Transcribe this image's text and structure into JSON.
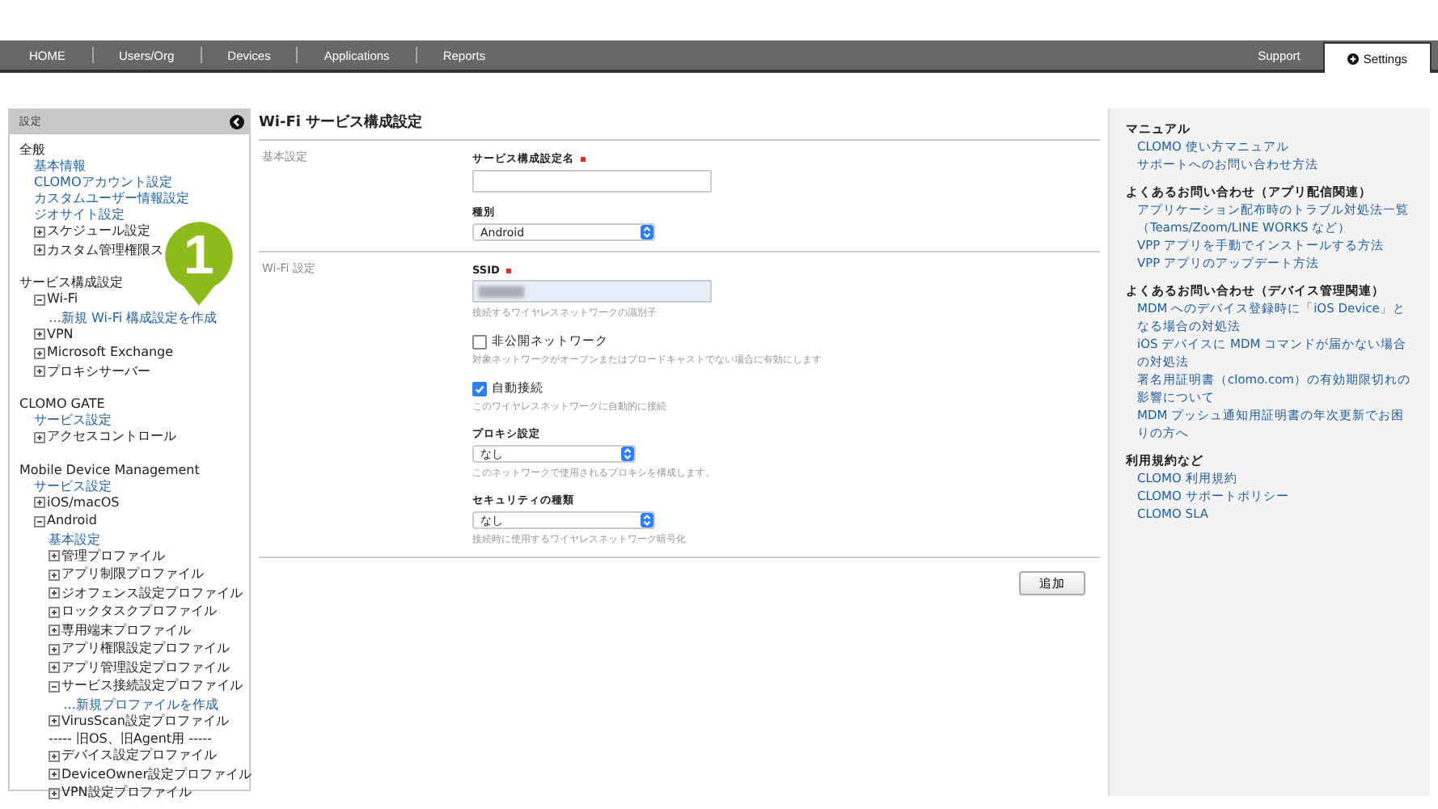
{
  "nav": {
    "tabs": [
      {
        "label": "HOME",
        "selected": false
      },
      {
        "label": "Users/Org",
        "selected": false
      },
      {
        "label": "Devices",
        "selected": false
      },
      {
        "label": "Applications",
        "selected": false
      },
      {
        "label": "Reports",
        "selected": false
      }
    ],
    "right_tabs": [
      {
        "label": "Support",
        "selected": false,
        "icon": false
      },
      {
        "label": "Settings",
        "selected": true,
        "icon": true
      }
    ]
  },
  "sidebar": {
    "title": "設定",
    "groups": [
      {
        "title": "全般",
        "children": [
          {
            "kind": "link",
            "label": "基本情報"
          },
          {
            "kind": "link",
            "label": "CLOMOアカウント設定"
          },
          {
            "kind": "link",
            "label": "カスタムユーザー情報設定"
          },
          {
            "kind": "link",
            "label": "ジオサイト設定"
          },
          {
            "kind": "node",
            "label": "スケジュール設定",
            "expanded": false
          },
          {
            "kind": "node",
            "label": "カスタム管理権限ス",
            "expanded": false
          }
        ]
      },
      {
        "title": "サービス構成設定",
        "children": [
          {
            "kind": "node",
            "label": "Wi-Fi",
            "expanded": true,
            "children": [
              {
                "kind": "link",
                "label": "…新規 Wi-Fi 構成設定を作成"
              }
            ]
          },
          {
            "kind": "node",
            "label": "VPN",
            "expanded": false
          },
          {
            "kind": "node",
            "label": "Microsoft Exchange",
            "expanded": false
          },
          {
            "kind": "node",
            "label": "プロキシサーバー",
            "expanded": false
          }
        ]
      },
      {
        "title": "CLOMO GATE",
        "children": [
          {
            "kind": "link",
            "label": "サービス設定"
          },
          {
            "kind": "node",
            "label": "アクセスコントロール",
            "expanded": false
          }
        ]
      },
      {
        "title": "Mobile Device Management",
        "children": [
          {
            "kind": "link",
            "label": "サービス設定"
          },
          {
            "kind": "node",
            "label": "iOS/macOS",
            "expanded": false
          },
          {
            "kind": "node",
            "label": "Android",
            "expanded": true,
            "children": [
              {
                "kind": "link",
                "label": "基本設定"
              },
              {
                "kind": "node",
                "label": "管理プロファイル",
                "expanded": false
              },
              {
                "kind": "node",
                "label": "アプリ制限プロファイル",
                "expanded": false
              },
              {
                "kind": "node",
                "label": "ジオフェンス設定プロファイル",
                "expanded": false
              },
              {
                "kind": "node",
                "label": "ロックタスクプロファイル",
                "expanded": false
              },
              {
                "kind": "node",
                "label": "専用端末プロファイル",
                "expanded": false
              },
              {
                "kind": "node",
                "label": "アプリ権限設定プロファイル",
                "expanded": false
              },
              {
                "kind": "node",
                "label": "アプリ管理設定プロファイル",
                "expanded": false
              },
              {
                "kind": "node",
                "label": "サービス接続設定プロファイル",
                "expanded": true,
                "children": [
                  {
                    "kind": "link",
                    "label": "…新規プロファイルを作成"
                  }
                ]
              },
              {
                "kind": "node",
                "label": "VirusScan設定プロファイル",
                "expanded": false
              },
              {
                "kind": "separator",
                "label": "----- 旧OS、旧Agent用 -----"
              },
              {
                "kind": "node",
                "label": "デバイス設定プロファイル",
                "expanded": false
              },
              {
                "kind": "node",
                "label": "DeviceOwner設定プロファイル",
                "expanded": false
              },
              {
                "kind": "node",
                "label": "VPN設定プロファイル",
                "expanded": false
              }
            ]
          }
        ]
      }
    ]
  },
  "marker": {
    "label": "1"
  },
  "main": {
    "title": "Wi-Fi サービス構成設定",
    "sections": [
      {
        "label": "基本設定",
        "fields": [
          {
            "kind": "text",
            "label": "サービス構成設定名",
            "required": true,
            "value_hidden": false
          },
          {
            "kind": "select",
            "label": "種別",
            "value": "Android"
          }
        ]
      },
      {
        "label": "Wi-Fi 設定",
        "fields": [
          {
            "kind": "text",
            "label": "SSID",
            "required": true,
            "value_hidden": true,
            "hint": "接続するワイヤレスネットワークの識別子"
          },
          {
            "kind": "checkbox",
            "label": "非公開ネットワーク",
            "checked": false,
            "hint": "対象ネットワークがオープンまたはブロードキャストでない場合に有効にします"
          },
          {
            "kind": "checkbox",
            "label": "自動接続",
            "checked": true,
            "hint": "このワイヤレスネットワークに自動的に接続"
          },
          {
            "kind": "select",
            "label": "プロキシ設定",
            "value": "なし",
            "hint": "このネットワークで使用されるプロキシを構成します。"
          },
          {
            "kind": "select",
            "label": "セキュリティの種類",
            "value": "なし",
            "hint": "接続時に使用するワイヤレスネットワーク暗号化"
          }
        ]
      }
    ],
    "submit": "追加"
  },
  "help": {
    "sections": [
      {
        "title": "マニュアル",
        "links": [
          "CLOMO 使い方マニュアル",
          "サポートへのお問い合わせ方法"
        ]
      },
      {
        "title": "よくあるお問い合わせ（アプリ配信関連）",
        "links": [
          "アプリケーション配布時のトラブル対処法一覧（Teams/Zoom/LINE WORKS など）",
          "VPP アプリを手動でインストールする方法",
          "VPP アプリのアップデート方法"
        ]
      },
      {
        "title": "よくあるお問い合わせ（デバイス管理関連）",
        "links": [
          "MDM へのデバイス登録時に「iOS Device」となる場合の対処法",
          "iOS デバイスに MDM コマンドが届かない場合の対処法",
          "署名用証明書（clomo.com）の有効期限切れの影響について",
          "MDM プッシュ通知用証明書の年次更新でお困りの方へ"
        ]
      },
      {
        "title": "利用規約など",
        "links": [
          "CLOMO 利用規約",
          "CLOMO サポートポリシー",
          "CLOMO SLA"
        ]
      }
    ]
  }
}
